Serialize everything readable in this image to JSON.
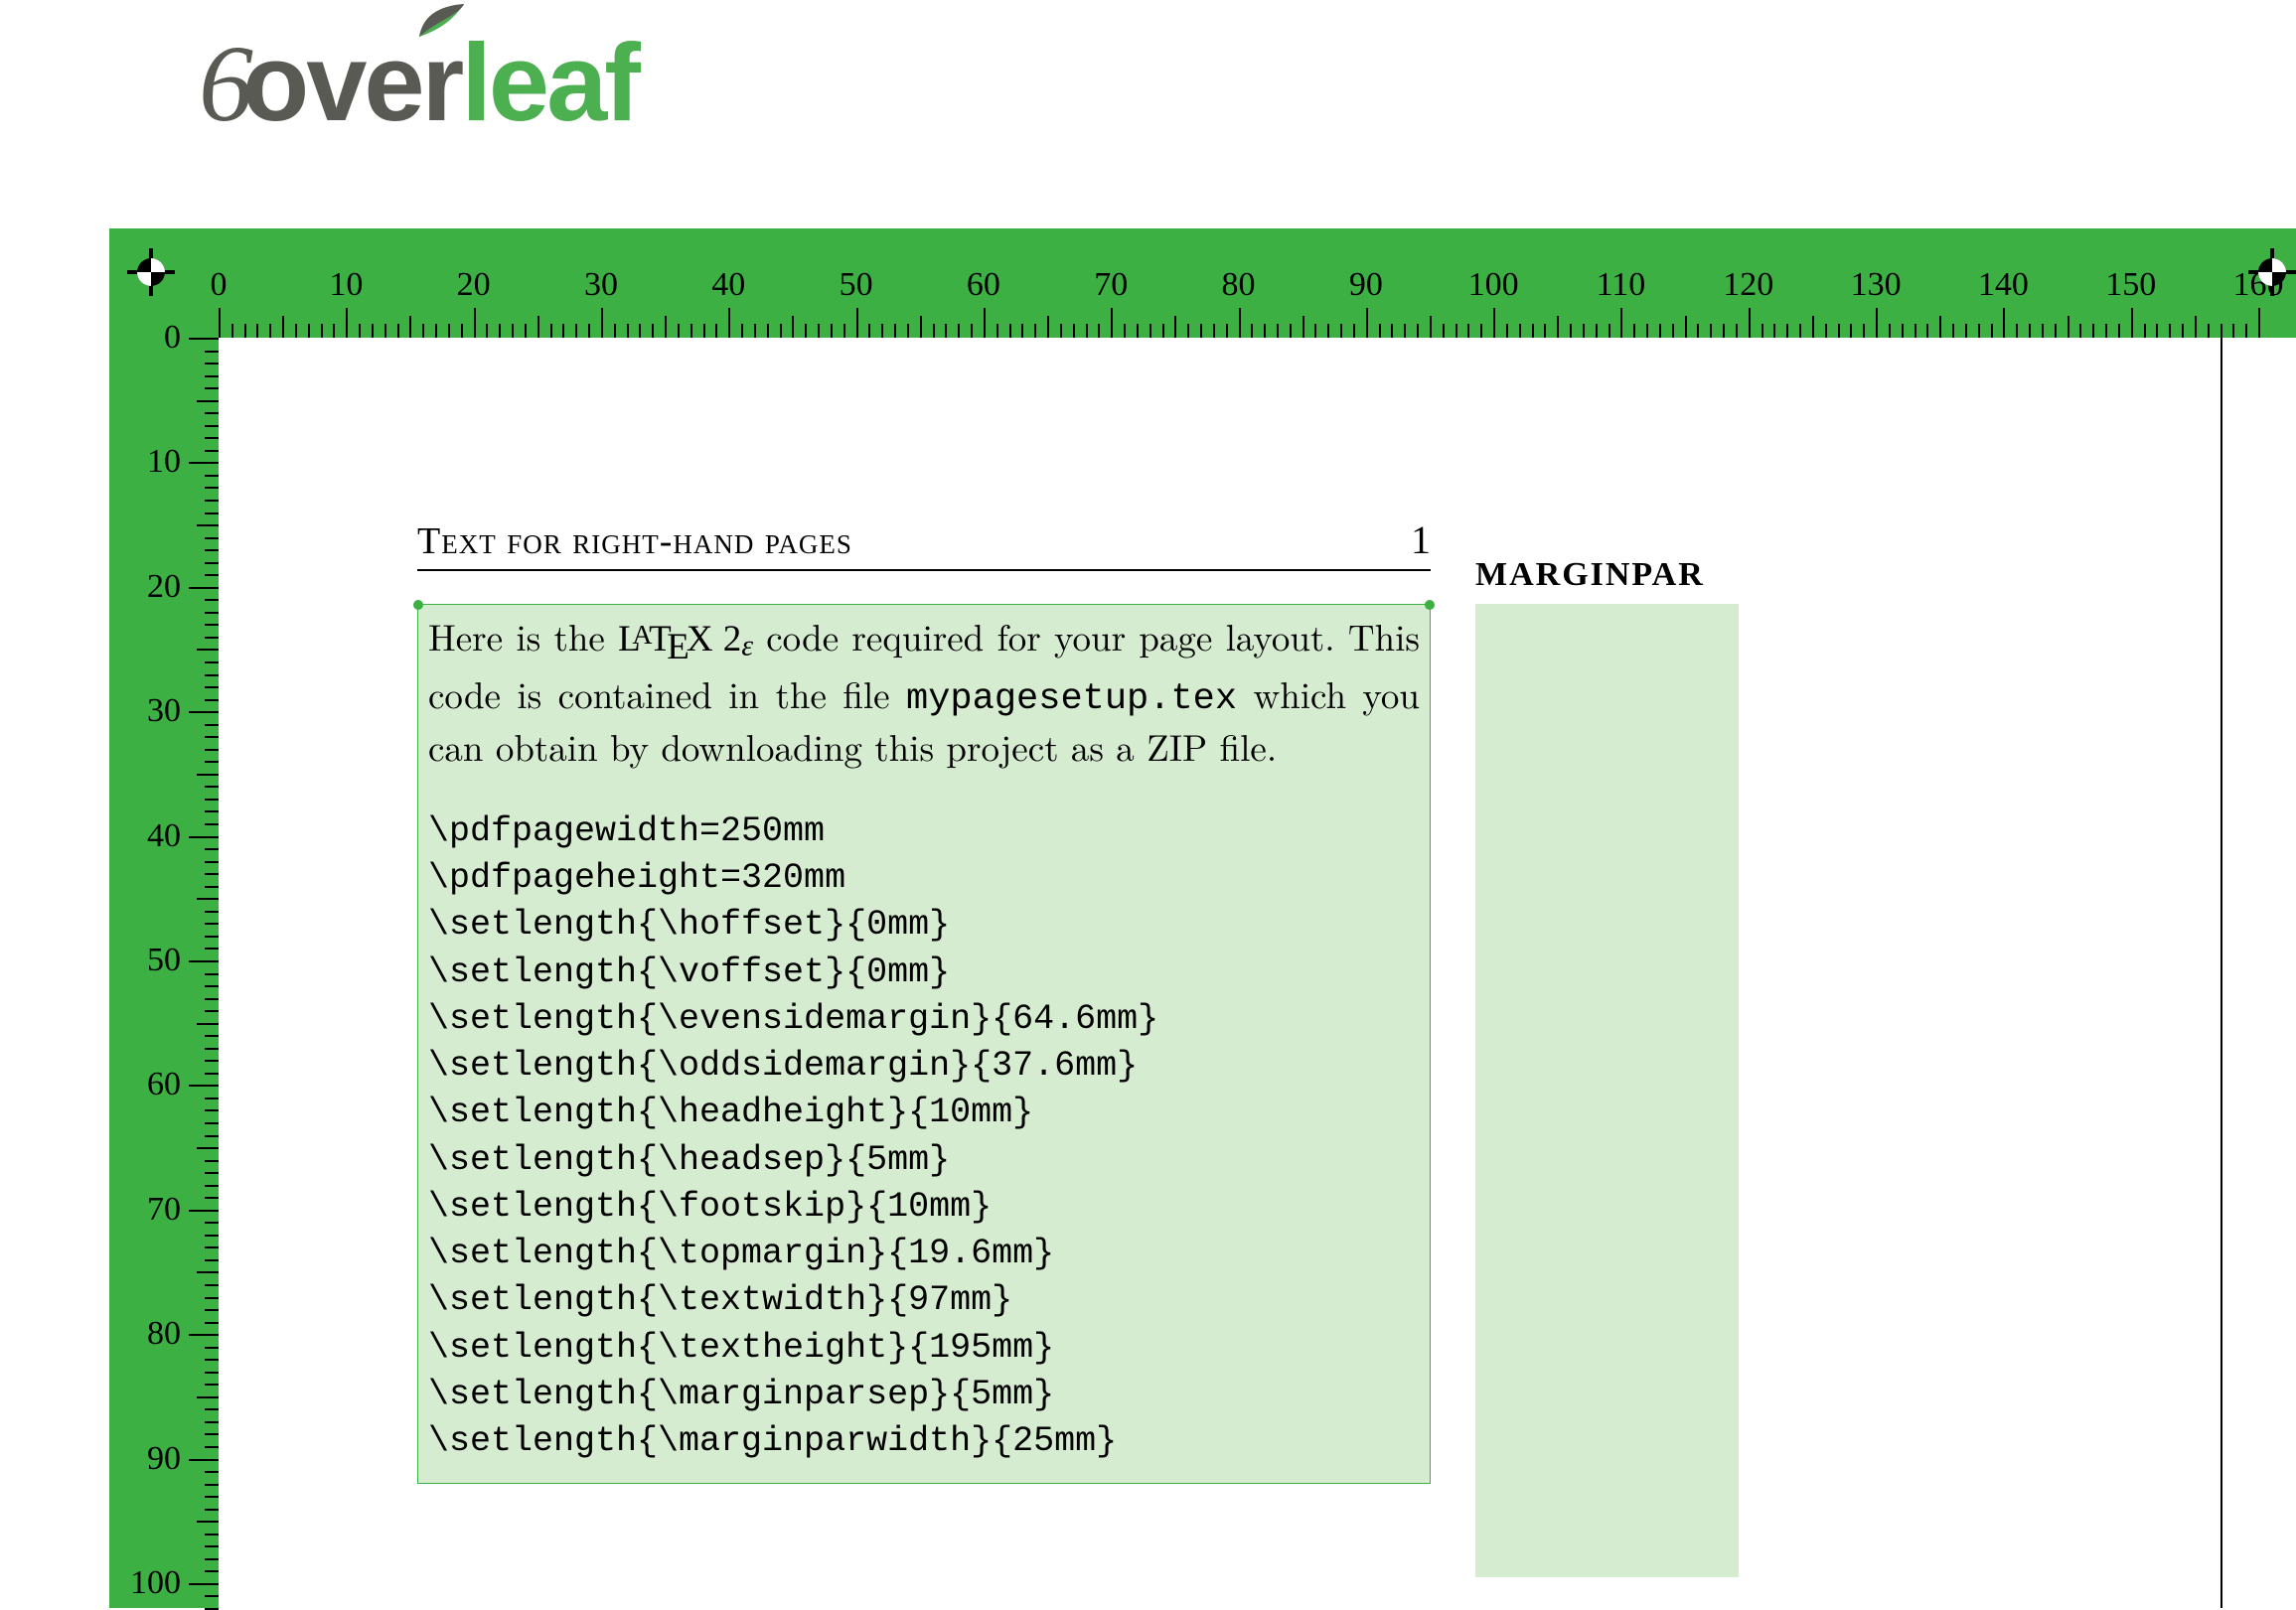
{
  "logo": {
    "over": "over",
    "leaf": "leaf"
  },
  "ruler": {
    "top_labels": [
      0,
      10,
      20,
      30,
      40,
      50,
      60,
      70,
      80,
      90,
      100,
      110,
      120,
      130,
      140,
      150,
      160
    ],
    "left_labels": [
      0,
      10,
      20,
      30,
      40,
      50,
      60,
      70,
      80,
      90,
      100
    ]
  },
  "page": {
    "header_title": "Text for right-hand pages",
    "page_number": "1",
    "intro_pre": "Here is the ",
    "intro_mid": " code required for your page layout.  This code is contained in the file ",
    "intro_file": "mypagesetup.tex",
    "intro_post": " which you can obtain by downloading this project as a ZIP file.",
    "marginpar_title": "MARGINPAR",
    "code_lines": [
      "\\pdfpagewidth=250mm",
      "\\pdfpageheight=320mm",
      "\\setlength{\\hoffset}{0mm}",
      "\\setlength{\\voffset}{0mm}",
      "\\setlength{\\evensidemargin}{64.6mm}",
      "\\setlength{\\oddsidemargin}{37.6mm}",
      "\\setlength{\\headheight}{10mm}",
      "\\setlength{\\headsep}{5mm}",
      "\\setlength{\\footskip}{10mm}",
      "\\setlength{\\topmargin}{19.6mm}",
      "\\setlength{\\textwidth}{97mm}",
      "\\setlength{\\textheight}{195mm}",
      "\\setlength{\\marginparsep}{5mm}",
      "\\setlength{\\marginparwidth}{25mm}"
    ]
  }
}
